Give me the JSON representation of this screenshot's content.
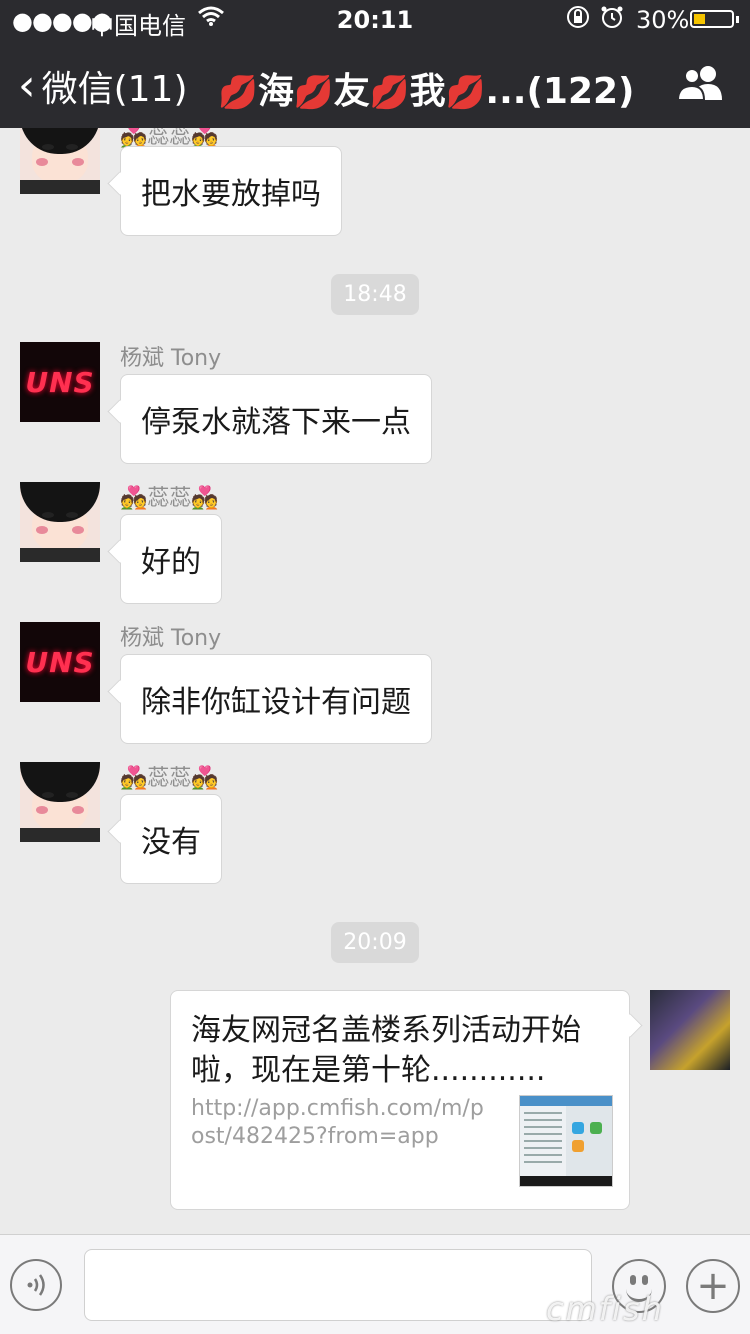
{
  "status_bar": {
    "signal": "●●●●●",
    "carrier": "中国电信",
    "time": "20:11",
    "battery_percent": "30%",
    "battery_level": 0.3
  },
  "nav": {
    "back_label": "微信(11)",
    "title_parts": [
      "海",
      "友",
      "我",
      "...(122)"
    ],
    "lip_emoji": "💋"
  },
  "messages": {
    "m0": {
      "sender": "💑蕊蕊💑",
      "text": "把水要放掉吗"
    },
    "t1": "18:48",
    "m1": {
      "sender": "杨斌 Tony",
      "text": "停泵水就落下来一点"
    },
    "m2": {
      "sender": "💑蕊蕊💑",
      "text": "好的"
    },
    "m3": {
      "sender": "杨斌 Tony",
      "text": "除非你缸设计有问题"
    },
    "m4": {
      "sender": "💑蕊蕊💑",
      "text": "没有"
    },
    "t2": "20:09",
    "m5": {
      "title": "海友网冠名盖楼系列活动开始啦，现在是第十轮............",
      "url": "http://app.cmfish.com/m/post/482425?from=app"
    }
  },
  "avatars": {
    "uns_text": "UNS"
  },
  "input": {
    "placeholder": ""
  },
  "watermark": "cmfish",
  "colors": {
    "nav_bg": "#2b2b2f",
    "chat_bg": "#ebebeb",
    "lip_red": "#d4223a"
  }
}
